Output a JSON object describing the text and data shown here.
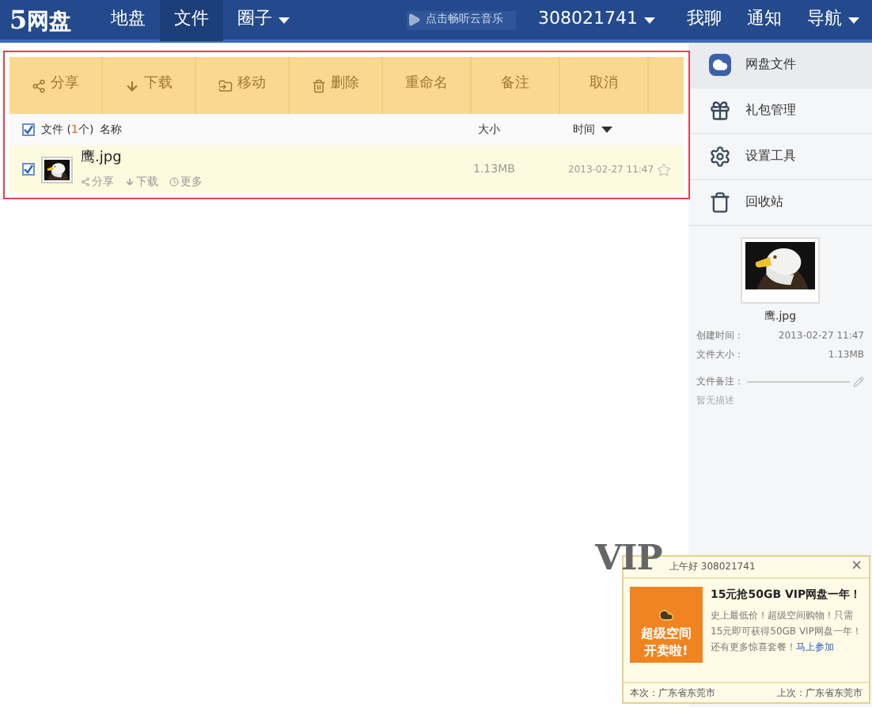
{
  "nav": {
    "logo_digit": "5",
    "logo_text": "网盘",
    "items": [
      {
        "label": "地盘",
        "selected": false,
        "dropdown": false
      },
      {
        "label": "文件",
        "selected": true,
        "dropdown": false
      },
      {
        "label": "圈子",
        "selected": false,
        "dropdown": true
      }
    ],
    "music": "点击畅听云音乐",
    "user": "308021741",
    "links": [
      {
        "label": "我聊",
        "dropdown": false
      },
      {
        "label": "通知",
        "dropdown": false
      },
      {
        "label": "导航",
        "dropdown": true
      }
    ]
  },
  "toolbar": [
    {
      "label": "分享",
      "kind": "share"
    },
    {
      "label": "下载",
      "kind": "download"
    },
    {
      "label": "移动",
      "kind": "move"
    },
    {
      "label": "删除",
      "kind": "delete"
    },
    {
      "label": "重命名",
      "kind": "plain"
    },
    {
      "label": "备注",
      "kind": "plain"
    },
    {
      "label": "取消",
      "kind": "plain"
    }
  ],
  "table": {
    "all_checked": true,
    "files_prefix": "文件 (",
    "files_count": "1",
    "files_suffix": "个)",
    "columns": [
      "名称",
      "大小",
      "时间"
    ],
    "rows": [
      {
        "name": "鹰.jpg",
        "checked": true,
        "actions": [
          {
            "label": "分享",
            "kind": "share"
          },
          {
            "label": "下载",
            "kind": "download"
          },
          {
            "label": "更多",
            "kind": "more"
          }
        ],
        "size": "1.13MB",
        "time": "2013-02-27 11:47",
        "starred": false
      }
    ]
  },
  "sidebar": {
    "items": [
      {
        "label": "网盘文件",
        "kind": "files",
        "selected": true
      },
      {
        "label": "礼包管理",
        "kind": "gifts",
        "selected": false
      },
      {
        "label": "设置工具",
        "kind": "settings",
        "selected": false
      },
      {
        "label": "回收站",
        "kind": "recycle",
        "selected": false
      }
    ],
    "detail": {
      "name": "鹰.jpg",
      "fields": [
        {
          "label": "创建时间：",
          "value": "2013-02-27 11:47"
        },
        {
          "label": "文件大小：",
          "value": "1.13MB"
        }
      ],
      "note_label": "文件备注：",
      "note": "暂无描述"
    }
  },
  "popup": {
    "vip": "VIP",
    "greeting": "上午好 308021741",
    "close": "×",
    "banner_lines": [
      "超级空间",
      "开卖啦!"
    ],
    "title": "15元抢50GB VIP网盘一年！",
    "body": "史上最低价！超级空间购物！只需15元即可获得50GB VIP网盘一年！还有更多惊喜套餐！",
    "link": "马上参加",
    "footer_left": "本次：广东省东莞市",
    "footer_right": "上次：广东省东莞市"
  }
}
